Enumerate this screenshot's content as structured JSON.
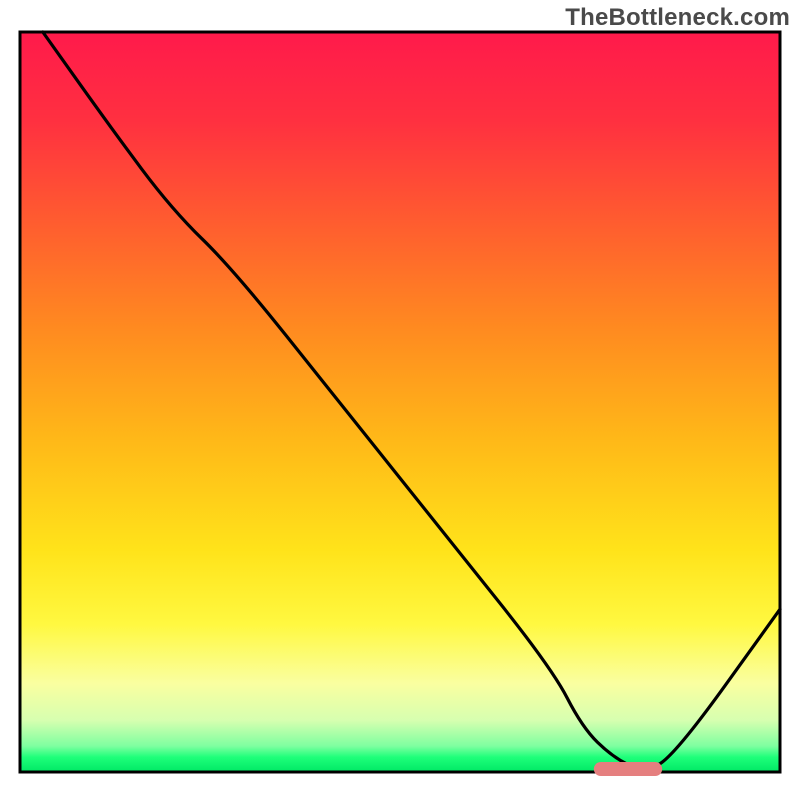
{
  "watermark": "TheBottleneck.com",
  "chart_data": {
    "type": "line",
    "title": "",
    "xlabel": "",
    "ylabel": "",
    "xlim": [
      0,
      100
    ],
    "ylim": [
      0,
      100
    ],
    "grid": false,
    "legend": false,
    "background_gradient": {
      "direction": "vertical",
      "stops": [
        {
          "pct": 0,
          "color": "#ff1a4b"
        },
        {
          "pct": 12,
          "color": "#ff3040"
        },
        {
          "pct": 25,
          "color": "#ff5a30"
        },
        {
          "pct": 40,
          "color": "#ff8a20"
        },
        {
          "pct": 55,
          "color": "#ffb818"
        },
        {
          "pct": 70,
          "color": "#ffe31a"
        },
        {
          "pct": 80,
          "color": "#fff840"
        },
        {
          "pct": 88,
          "color": "#faffa0"
        },
        {
          "pct": 93,
          "color": "#d7ffb0"
        },
        {
          "pct": 96.5,
          "color": "#7effa0"
        },
        {
          "pct": 98,
          "color": "#1eff7a"
        },
        {
          "pct": 100,
          "color": "#00e865"
        }
      ]
    },
    "series": [
      {
        "name": "bottleneck-curve",
        "x": [
          3,
          12,
          20,
          28,
          42,
          56,
          70,
          74,
          78,
          82,
          86,
          100
        ],
        "y": [
          100,
          87,
          76,
          68,
          50,
          32,
          14,
          6,
          2,
          0,
          2,
          22
        ]
      }
    ],
    "marker": {
      "name": "optimal-zone",
      "x_center": 80,
      "y": 0.4,
      "width_pct": 9,
      "color": "#e57f7f"
    },
    "frame_inset_pct": {
      "left": 2.5,
      "right": 2.5,
      "top": 4.0,
      "bottom": 3.5
    }
  }
}
